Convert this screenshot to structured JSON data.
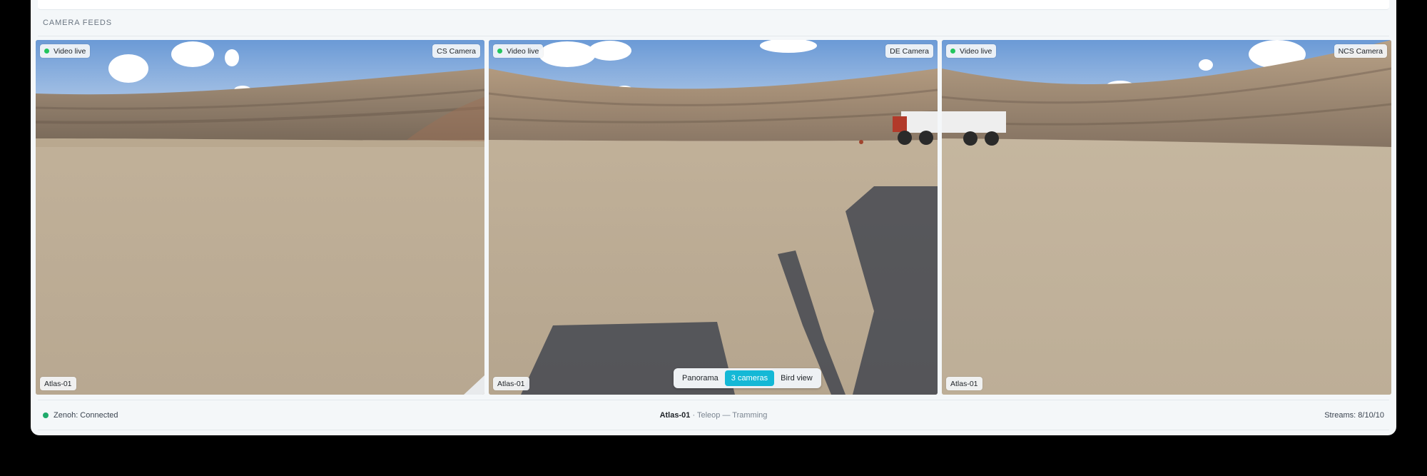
{
  "section": {
    "title": "CAMERA FEEDS"
  },
  "feeds": [
    {
      "status": "Video live",
      "camera": "CS Camera",
      "unit": "Atlas-01"
    },
    {
      "status": "Video live",
      "camera": "DE Camera",
      "unit": "Atlas-01"
    },
    {
      "status": "Video live",
      "camera": "NCS Camera",
      "unit": "Atlas-01"
    }
  ],
  "view_modes": [
    "Panorama",
    "3 cameras",
    "Bird view"
  ],
  "active_view": "3 cameras",
  "status_bar": {
    "connection": "Zenoh: Connected",
    "unit": "Atlas-01",
    "separator": "·",
    "mode": "Teleop — Tramming",
    "streams": "Streams: 8/10/10"
  },
  "colors": {
    "accent": "#14b8d6",
    "live": "#22c55e",
    "connected": "#1faa6b"
  }
}
